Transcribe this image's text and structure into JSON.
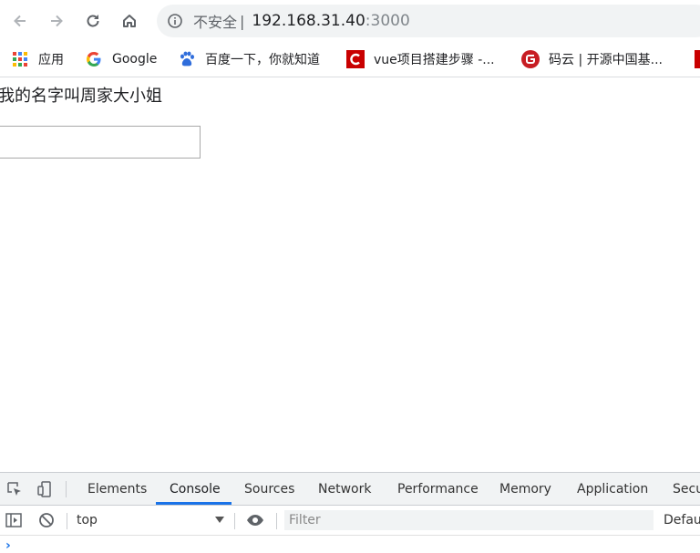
{
  "toolbar": {
    "back_icon": "arrow-left-icon",
    "forward_icon": "arrow-right-icon",
    "reload_icon": "reload-icon",
    "home_icon": "home-icon",
    "info_icon": "info-circle-icon",
    "security_label": "不安全",
    "separator": "|",
    "host": "192.168.31.40",
    "port": ":3000"
  },
  "bookmarks": [
    {
      "label": "应用",
      "icon": "apps-grid-icon"
    },
    {
      "label": "Google",
      "icon": "google-icon"
    },
    {
      "label": "百度一下，你就知道",
      "icon": "baidu-paw-icon"
    },
    {
      "label": "vue项目搭建步骤 -...",
      "icon": "csdn-icon"
    },
    {
      "label": "码云 | 开源中国基...",
      "icon": "gitee-icon"
    }
  ],
  "page": {
    "heading": "我的名字叫周家大小姐",
    "input_value": ""
  },
  "devtools": {
    "tabs": [
      "Elements",
      "Console",
      "Sources",
      "Network",
      "Performance",
      "Memory",
      "Application",
      "Secu"
    ],
    "active_tab": "Console",
    "context": "top",
    "filter_placeholder": "Filter",
    "levels": "Defau",
    "prompt": "›"
  },
  "colors": {
    "accent": "#1a73e8",
    "omnibox_bg": "#f1f3f4"
  }
}
